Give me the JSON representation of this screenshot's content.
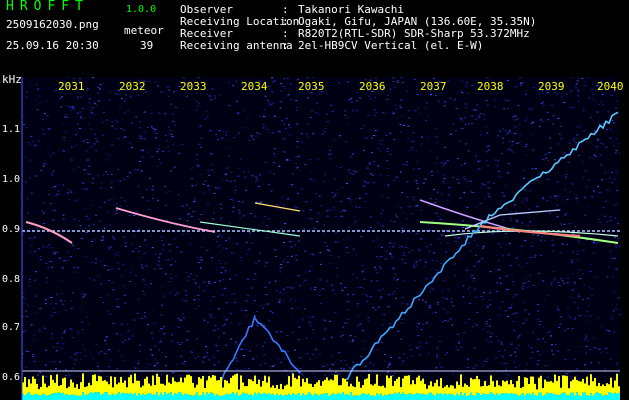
{
  "app": {
    "title": "HROFFT",
    "version": "1.0.0"
  },
  "file": {
    "name": "2509162030.png"
  },
  "datetime": "25.09.16 20:30",
  "meteor": {
    "label": "meteor",
    "count": "39"
  },
  "info": [
    {
      "label": "Observer",
      "value": "Takanori Kawachi"
    },
    {
      "label": "Receiving Location",
      "value": "Ogaki, Gifu, JAPAN (136.60E, 35.35N)"
    },
    {
      "label": "Receiver",
      "value": "R820T2(RTL-SDR) SDR-Sharp 53.372MHz"
    },
    {
      "label": "Receiving antenna",
      "value": "2el-HB9CV Vertical (el. E-W)"
    }
  ],
  "axis": {
    "unit": "kHz",
    "x_ticks": [
      "2031",
      "2032",
      "2033",
      "2034",
      "2035",
      "2036",
      "2037",
      "2038",
      "2039",
      "2040"
    ],
    "y_ticks": [
      "1.1",
      "1.0",
      "0.9",
      "0.8",
      "0.7",
      "0.6"
    ]
  },
  "colors": {
    "label_green": "#00ff00",
    "tick_yellow": "#ffff00",
    "background": "#000014",
    "noise_blue": "#2a3bd8",
    "carrier": "#b0c8ff",
    "bars_yellow": "#ffff00",
    "bars_cyan": "#00ffff"
  }
}
